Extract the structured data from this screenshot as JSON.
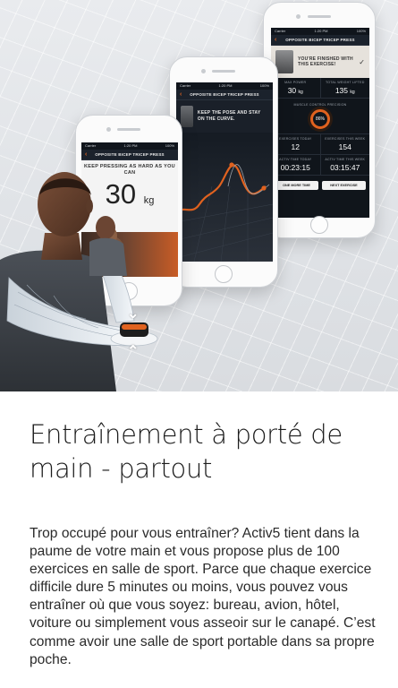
{
  "colors": {
    "accent": "#e0621f",
    "screen_bg": "#141a22",
    "page_bg": "#ffffff",
    "title_text": "#1c1c1c"
  },
  "phone1": {
    "statusbar_left": "Carrier",
    "statusbar_time": "1:20 PM",
    "statusbar_right": "100%",
    "exercise_name": "OPPOSITE BICEP TRICEP PRESS",
    "instruction": "KEEP PRESSING AS HARD AS YOU CAN",
    "value": "30",
    "unit": "kg"
  },
  "phone2": {
    "statusbar_left": "Carrier",
    "statusbar_time": "1:20 PM",
    "statusbar_right": "100%",
    "exercise_name": "OPPOSITE BICEP TRICEP PRESS",
    "message": "KEEP THE POSE AND STAY ON THE CURVE."
  },
  "phone3": {
    "statusbar_left": "Carrier",
    "statusbar_time": "1:20 PM",
    "statusbar_right": "100%",
    "exercise_name": "OPPOSITE BICEP TRICEP PRESS",
    "message": "YOU'RE FINISHED WITH THIS EXERCISE!",
    "stats_row1": [
      {
        "label": "MAX POWER",
        "value": "30",
        "unit": "kg"
      },
      {
        "label": "TOTAL WEIGHT LIFTED",
        "value": "135",
        "unit": "kg"
      }
    ],
    "precision_label": "MUSCLE CONTROL PRECISION",
    "precision_value": "86%",
    "stats_row2": [
      {
        "label": "EXERCISES TODAY",
        "value": "12"
      },
      {
        "label": "EXERCISES THIS WEEK",
        "value": "154"
      }
    ],
    "stats_row3": [
      {
        "label": "ACTIV TIME TODAY",
        "value": "00:23:15"
      },
      {
        "label": "ACTIV TIME THIS WEEK",
        "value": "03:15:47"
      }
    ],
    "btn_more": "ONE MORE TIME",
    "btn_next": "NEXT EXERCISE"
  },
  "content": {
    "title_line1": "Entraînement à porté de",
    "title_line2": "main - partout",
    "body": "Trop occupé pour vous entraîner? Activ5 tient dans la paume de votre main et vous propose plus de 100 exercices en salle de sport. Parce que chaque exercice difficile dure 5 minutes ou moins, vous pouvez vous entraîner où que vous soyez: bureau, avion, hôtel, voiture ou simplement vous asseoir sur le canapé. C’est comme avoir une salle de sport portable dans sa propre poche."
  }
}
